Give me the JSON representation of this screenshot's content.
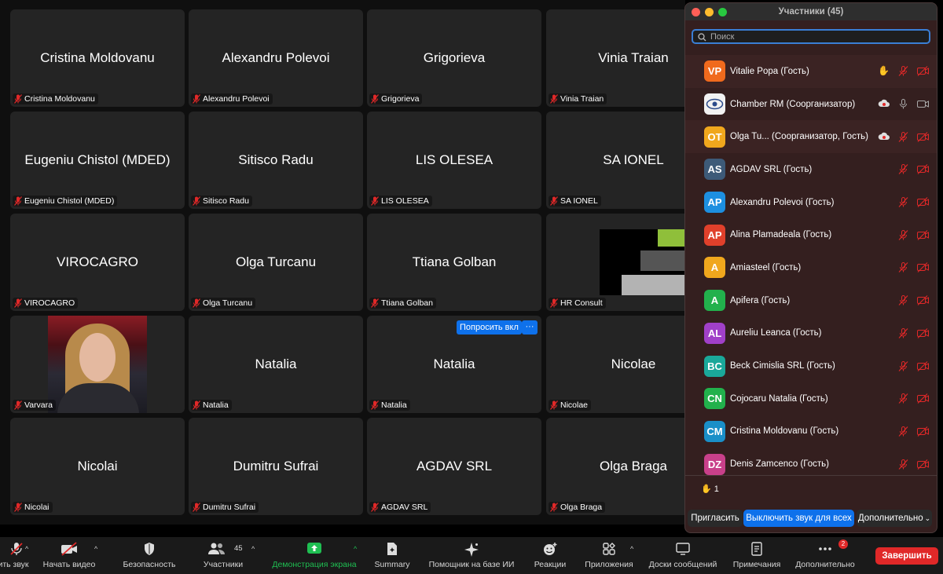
{
  "grid": {
    "tiles": [
      {
        "name": "Cristina Moldovanu",
        "label": "Cristina Moldovanu"
      },
      {
        "name": "Alexandru Polevoi",
        "label": "Alexandru Polevoi"
      },
      {
        "name": "Grigorieva",
        "label": "Grigorieva"
      },
      {
        "name": "Vinia Traian",
        "label": "Vinia Traian"
      },
      {
        "name": "Eugeniu Chistol (MDED)",
        "label": "Eugeniu Chistol (MDED)"
      },
      {
        "name": "Sitisco Radu",
        "label": "Sitisco Radu"
      },
      {
        "name": "LIS OLESEA",
        "label": "LIS OLESEA"
      },
      {
        "name": "SA IONEL",
        "label": "SA IONEL"
      },
      {
        "name": "VIROCAGRO",
        "label": "VIROCAGRO"
      },
      {
        "name": "Olga Turcanu",
        "label": "Olga Turcanu"
      },
      {
        "name": "Ttiana Golban",
        "label": "Ttiana Golban"
      },
      {
        "name": "",
        "label": "HR Consult"
      },
      {
        "name": "",
        "label": "Varvara"
      },
      {
        "name": "Natalia",
        "label": "Natalia"
      },
      {
        "name": "Natalia",
        "label": "Natalia"
      },
      {
        "name": "Nicolae",
        "label": "Nicolae"
      },
      {
        "name": "Nicolai",
        "label": "Nicolai"
      },
      {
        "name": "Dumitru Sufrai",
        "label": "Dumitru Sufrai"
      },
      {
        "name": "AGDAV SRL",
        "label": "AGDAV SRL"
      },
      {
        "name": "Olga Braga",
        "label": "Olga Braga"
      }
    ],
    "ask_unmute_label": "Попросить вкл",
    "more_label": "···"
  },
  "panel": {
    "title": "Участники (45)",
    "search_placeholder": "Поиск",
    "participants": [
      {
        "initials": "VP",
        "name": "Vitalie Popa (Гость)",
        "color": "#f06a1d"
      },
      {
        "initials": "",
        "name": "Chamber RM (Соорганизатор)",
        "color": "#f2f2f2"
      },
      {
        "initials": "OT",
        "name": "Olga Tu...  (Соорганизатор, Гость)",
        "color": "#f0a71d"
      },
      {
        "initials": "AS",
        "name": "AGDAV SRL (Гость)",
        "color": "#3d5a78"
      },
      {
        "initials": "AP",
        "name": "Alexandru Polevoi (Гость)",
        "color": "#1d8fe0"
      },
      {
        "initials": "AP",
        "name": "Alina Plamadeala (Гость)",
        "color": "#e0402b"
      },
      {
        "initials": "A",
        "name": "Amiasteel (Гость)",
        "color": "#f0a71d"
      },
      {
        "initials": "A",
        "name": "Apifera (Гость)",
        "color": "#22b14c"
      },
      {
        "initials": "AL",
        "name": "Aureliu Leanca (Гость)",
        "color": "#a040c8"
      },
      {
        "initials": "BC",
        "name": "Beck Cimislia SRL (Гость)",
        "color": "#1aa89a"
      },
      {
        "initials": "CN",
        "name": "Cojocaru Natalia (Гость)",
        "color": "#22b14c"
      },
      {
        "initials": "CM",
        "name": "Cristina Moldovanu (Гость)",
        "color": "#1a8fc8"
      },
      {
        "initials": "DZ",
        "name": "Denis Zamcenco (Гость)",
        "color": "#c8408a"
      }
    ],
    "raised_hands": "1",
    "invite_label": "Пригласить",
    "mute_all_label": "Выключить звук для всех",
    "more_label": "Дополнительно"
  },
  "toolbar": {
    "items": [
      {
        "label": "ить звук"
      },
      {
        "label": "Начать видео"
      },
      {
        "label": "Безопасность"
      },
      {
        "label": "Участники",
        "count": "45"
      },
      {
        "label": "Демонстрация экрана"
      },
      {
        "label": "Summary"
      },
      {
        "label": "Помощник на базе ИИ"
      },
      {
        "label": "Реакции"
      },
      {
        "label": "Приложения"
      },
      {
        "label": "Доски сообщений"
      },
      {
        "label": "Примечания"
      },
      {
        "label": "Дополнительно",
        "badge": "2"
      }
    ],
    "end_label": "Завершить"
  },
  "colors": {
    "accent": "#0e71eb",
    "danger": "#e02828",
    "share_green": "#1fbf52",
    "panel_bg": "#341f1f",
    "tile_bg": "#242424"
  }
}
